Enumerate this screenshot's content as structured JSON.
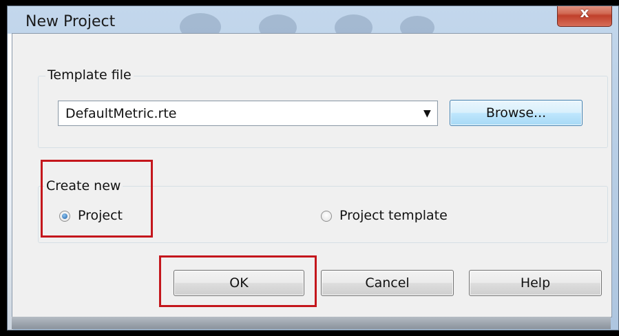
{
  "window": {
    "title": "New Project",
    "close_glyph": "x"
  },
  "template_group": {
    "label": "Template file",
    "template_value": "DefaultMetric.rte",
    "dropdown_arrow": "▼",
    "browse_label": "Browse..."
  },
  "create_group": {
    "label": "Create new",
    "options": [
      {
        "label": "Project",
        "selected": true
      },
      {
        "label": "Project template",
        "selected": false
      }
    ]
  },
  "buttons": {
    "ok": "OK",
    "cancel": "Cancel",
    "help": "Help"
  },
  "colors": {
    "highlight": "#c4161c",
    "close_button": "#c0402b",
    "radio_selected": "#1c5fa8"
  }
}
